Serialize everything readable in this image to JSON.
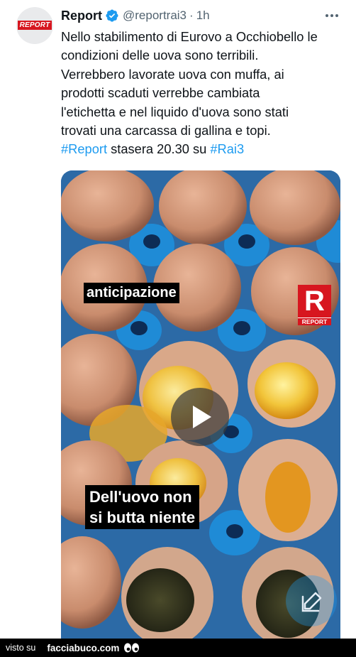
{
  "tweet": {
    "avatar_text": "REPORT",
    "name": "Report",
    "handle": "@reportrai3",
    "separator": "·",
    "time": "1h",
    "lines": [
      "Nello stabilimento di Eurovo a Occhiobello le",
      "condizioni delle uova sono terribili.",
      "Verrebbero lavorate uova con muffa, ai",
      "prodotti scaduti verrebbe cambiata",
      "l'etichetta e nel liquido d'uova sono stati",
      "trovati una carcassa di gallina e topi."
    ],
    "hashtag1": "#Report",
    "mid_text": " stasera 20.30 su ",
    "hashtag2": "#Rai3"
  },
  "media": {
    "caption_top": "anticipazione",
    "caption_bottom_1": "Dell'uovo non",
    "caption_bottom_2": "si butta niente",
    "logo_letter": "R",
    "logo_word": "REPORT"
  },
  "footer": {
    "seen_on": "visto su",
    "site": "facciabuco.com"
  },
  "colors": {
    "link": "#1d9bf0",
    "brand_red": "#d7161f",
    "tray_blue": "#2c6aa6"
  },
  "icons": [
    "verified-badge-icon",
    "more-options-icon",
    "play-icon",
    "compose-icon",
    "eyes-icon"
  ]
}
